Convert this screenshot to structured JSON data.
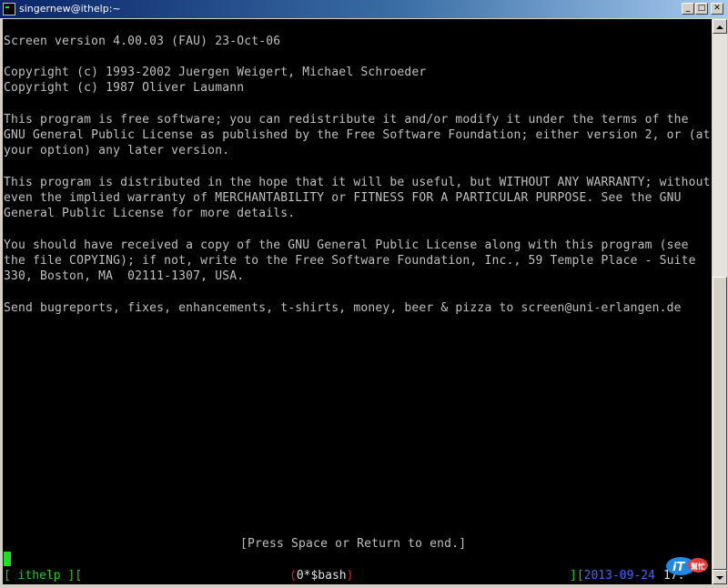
{
  "window": {
    "title": "singernew@ithelp:~",
    "controls": {
      "minimize": "_",
      "maximize": "□",
      "close": "✕"
    }
  },
  "terminal": {
    "lines": [
      "Screen version 4.00.03 (FAU) 23-Oct-06",
      "Copyright (c) 1993-2002 Juergen Weigert, Michael Schroeder",
      "Copyright (c) 1987 Oliver Laumann",
      "This program is free software; you can redistribute it and/or modify it under the terms of the",
      "GNU General Public License as published by the Free Software Foundation; either version 2, or (at",
      "your option) any later version.",
      "This program is distributed in the hope that it will be useful, but WITHOUT ANY WARRANTY; without",
      "even the implied warranty of MERCHANTABILITY or FITNESS FOR A PARTICULAR PURPOSE. See the GNU",
      "General Public License for more details.",
      "You should have received a copy of the GNU General Public License along with this program (see",
      "the file COPYING); if not, write to the Free Software Foundation, Inc., 59 Temple Place - Suite",
      "330, Boston, MA  02111-1307, USA.",
      "Send bugreports, fixes, enhancements, t-shirts, money, beer & pizza to screen@uni-erlangen.de"
    ],
    "prompt": "[Press Space or Return to end.]"
  },
  "statusbar": {
    "left": "[ ithelp ][",
    "window_open": "(",
    "window_name": "0*$bash",
    "window_close": ")",
    "right_bracket": "][",
    "date": "2013-09-24",
    "time": "17:"
  },
  "colors": {
    "terminal_bg": "#000000",
    "terminal_fg": "#c0c0c0",
    "status_green": "#22cc22",
    "status_red": "#dd2222",
    "status_blue": "#4466ff",
    "cursor": "#22dd22"
  },
  "watermark": {
    "text": "iT邦幫忙"
  }
}
